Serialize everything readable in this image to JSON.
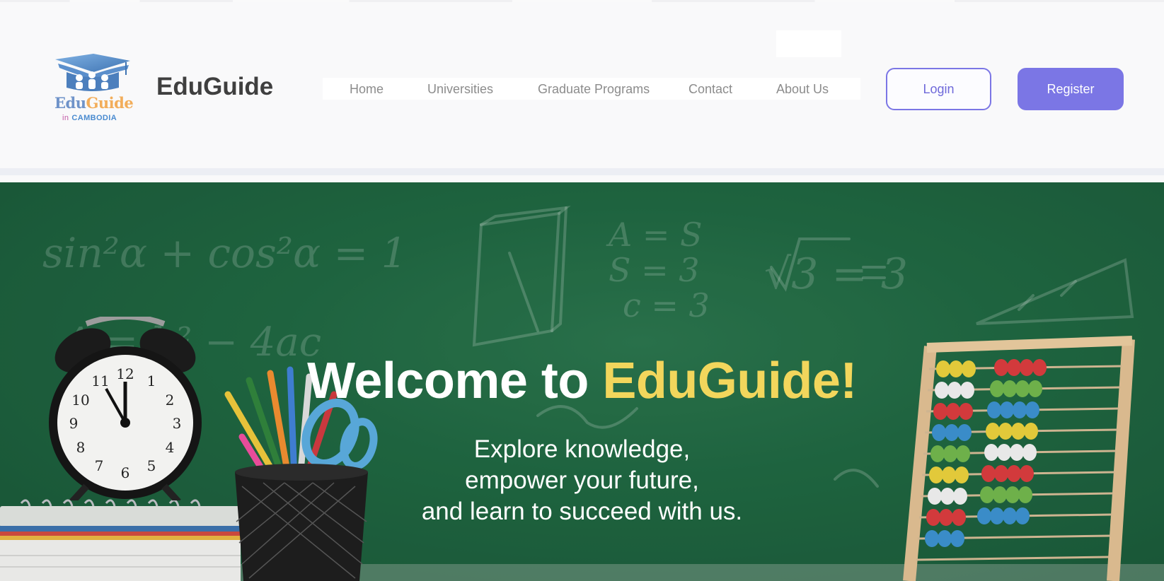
{
  "header": {
    "logo": {
      "word_edu": "Edu",
      "word_guide": "Guide",
      "sub_in": "in",
      "sub_country": "CAMBODIA"
    },
    "brand": "EduGuide",
    "nav": [
      {
        "label": "Home",
        "icon": null
      },
      {
        "label": "Universities",
        "icon": null
      },
      {
        "label": "Graduate Programs",
        "icon": null
      },
      {
        "label": "Contact",
        "icon": null
      },
      {
        "label": "About Us",
        "icon": null
      }
    ],
    "login_label": "Login",
    "register_label": "Register"
  },
  "hero": {
    "title_prefix": "Welcome to ",
    "title_accent": "EduGuide!",
    "subtitle_lines": [
      "Explore knowledge,",
      "empower your future,",
      "and learn to succeed with us."
    ],
    "background_image": "chalkboard with math formulas, alarm clock, pencil cup and abacus",
    "clock_numerals": [
      "12",
      "1",
      "2",
      "3",
      "4",
      "5",
      "6",
      "7",
      "8",
      "9",
      "10",
      "11"
    ],
    "chalk_text": [
      "sin²α + cos²α = 1",
      "A = S",
      "S = 3",
      "c = 3",
      "√3 = 3",
      "Δ = b² − 4ac"
    ]
  },
  "colors": {
    "accent_purple": "#7b76e5",
    "title_yellow": "#f2d65c",
    "chalkboard_green": "#236c46",
    "brand_text": "#3f3f3f",
    "nav_text": "#8c8c8c"
  }
}
